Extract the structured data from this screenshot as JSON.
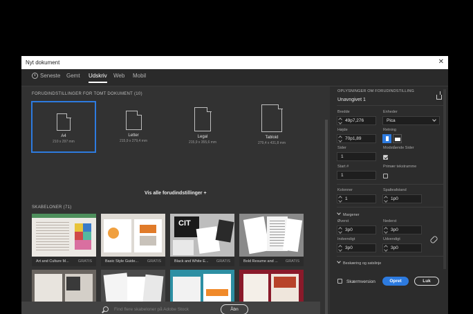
{
  "dialog": {
    "title": "Nyt dokument",
    "close_glyph": "✕"
  },
  "tabs": [
    {
      "label": "Seneste",
      "icon": "clock-icon"
    },
    {
      "label": "Gemt"
    },
    {
      "label": "Udskriv",
      "active": true
    },
    {
      "label": "Web"
    },
    {
      "label": "Mobil"
    }
  ],
  "presets": {
    "heading": "FORUDINDSTILLINGER FOR TOMT DOKUMENT  (10)",
    "items": [
      {
        "name": "A4",
        "size": "210 x 297 mm",
        "selected": true
      },
      {
        "name": "Letter",
        "size": "215,9 x 279,4 mm"
      },
      {
        "name": "Legal",
        "size": "215,9 x 355,6 mm"
      },
      {
        "name": "Tabloid",
        "size": "279,4 x 431,8 mm"
      }
    ],
    "see_all": "Vis alle forudindstillinger +"
  },
  "templates": {
    "heading": "SKABELONER  (71)",
    "items": [
      {
        "name": "Art and Culture M...",
        "price": "GRATIS"
      },
      {
        "name": "Basic Style Guide...",
        "price": "GRATIS"
      },
      {
        "name": "Black and White E...",
        "price": "GRATIS"
      },
      {
        "name": "Bold Resume and ...",
        "price": "GRATIS"
      },
      {
        "name": "",
        "price": ""
      },
      {
        "name": "",
        "price": ""
      },
      {
        "name": "",
        "price": ""
      },
      {
        "name": "",
        "price": ""
      }
    ],
    "search_placeholder": "Find flere skabeloner på Adobe Stock",
    "open_label": "Åbn"
  },
  "details": {
    "heading": "OPLYSNINGER OM FORUDINDSTILLING",
    "doc_name": "Unavngivet 1",
    "width_label": "Bredde",
    "width_value": "49p7,276",
    "units_label": "Enheder",
    "units_value": "Pica",
    "height_label": "Højde",
    "height_value": "70p1,89",
    "orientation_label": "Retning",
    "pages_label": "Sider",
    "pages_value": "1",
    "facing_label": "Modstående Sider",
    "start_label": "Start #",
    "start_value": "1",
    "primary_frame_label": "Primær tekstramme",
    "columns_label": "Kolonner",
    "columns_value": "1",
    "gutter_label": "Spalteafstand",
    "gutter_value": "1p0",
    "margins_label": "Margener",
    "top_label": "Øverst",
    "top_value": "3p0",
    "bottom_label": "Nederst",
    "bottom_value": "3p0",
    "inside_label": "Indvendigt",
    "inside_value": "3p0",
    "outside_label": "Udvendigt",
    "outside_value": "3p0",
    "bleed_label": "Beskæring og satslinje",
    "preview_label": "Skærmversion",
    "create_label": "Opret",
    "close_label": "Luk"
  }
}
